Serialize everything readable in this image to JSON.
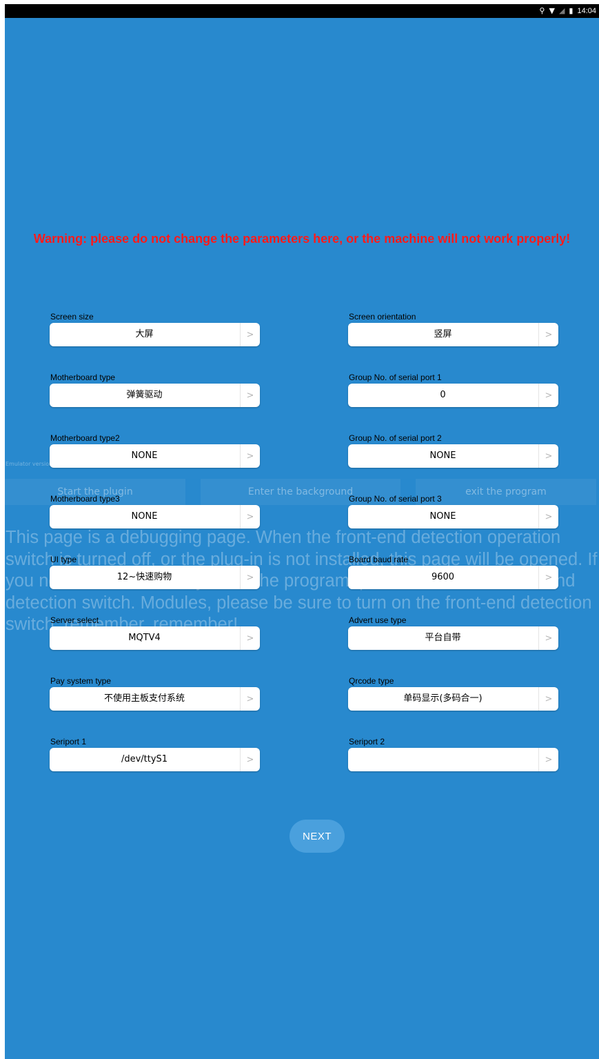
{
  "status_bar": {
    "time": "14:04",
    "icons": [
      "location-icon",
      "wifi-icon",
      "no-sim-icon",
      "battery-icon"
    ]
  },
  "background": {
    "debug_label": "Emulator version",
    "buttons": [
      "Start the plugin",
      "Enter the background",
      "exit the program"
    ],
    "paragraph": "This page is a debugging page. When the front-end detection operation switch is turned off, or the plug-in is not installed, this page will be opened. If you need to automatically enter the program, please turn on the front-end detection switch. Modules, please be sure to turn on the front-end detection switch, remember, remember!"
  },
  "warning": "Warning: please do not change the parameters here, or the machine will not work properly!",
  "settings": [
    {
      "label": "Screen size",
      "value": "大屏"
    },
    {
      "label": "Screen orientation",
      "value": "竖屏"
    },
    {
      "label": "Motherboard type",
      "value": "弹簧驱动"
    },
    {
      "label": "Group No. of serial port 1",
      "value": "0"
    },
    {
      "label": "Motherboard type2",
      "value": "NONE"
    },
    {
      "label": "Group No. of serial port 2",
      "value": "NONE"
    },
    {
      "label": "Motherboard type3",
      "value": "NONE"
    },
    {
      "label": "Group No. of serial port 3",
      "value": "NONE"
    },
    {
      "label": "UI type",
      "value": "12~快速购物"
    },
    {
      "label": "Board baud rate",
      "value": "9600"
    },
    {
      "label": "Server select",
      "value": "MQTV4"
    },
    {
      "label": "Advert use type",
      "value": "平台自带"
    },
    {
      "label": "Pay system type",
      "value": "不使用主板支付系统"
    },
    {
      "label": "Qrcode type",
      "value": "单码显示(多码合一)"
    },
    {
      "label": "Seriport 1",
      "value": "/dev/ttyS1"
    },
    {
      "label": "Seriport 2",
      "value": ""
    }
  ],
  "next_label": "NEXT",
  "colors": {
    "background": "#2889ce",
    "warning": "#ff1a1a",
    "next_button": "#4aa0dd"
  }
}
